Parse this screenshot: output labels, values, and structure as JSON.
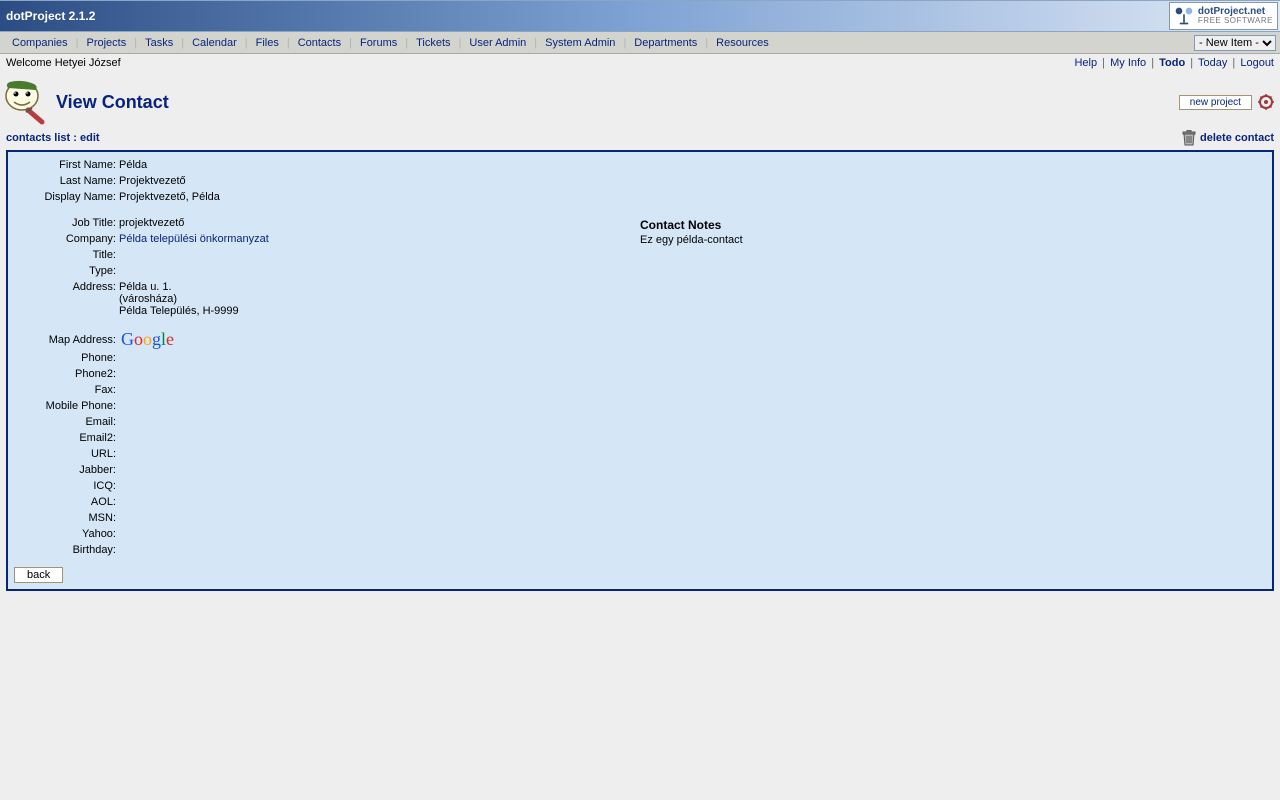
{
  "header": {
    "title": "dotProject 2.1.2",
    "logo_line1": "dotProject.net",
    "logo_line2": "FREE SOFTWARE"
  },
  "nav": {
    "items": [
      "Companies",
      "Projects",
      "Tasks",
      "Calendar",
      "Files",
      "Contacts",
      "Forums",
      "Tickets",
      "User Admin",
      "System Admin",
      "Departments",
      "Resources"
    ],
    "dropdown_selected": "- New Item -"
  },
  "util": {
    "welcome": "Welcome Hetyei József",
    "links": {
      "help": "Help",
      "myinfo": "My Info",
      "todo": "Todo",
      "today": "Today",
      "logout": "Logout"
    }
  },
  "page": {
    "title": "View Contact",
    "new_project": "new project",
    "crumb_list": "contacts list",
    "crumb_edit": "edit",
    "delete": "delete contact",
    "back": "back"
  },
  "labels": {
    "first_name": "First Name:",
    "last_name": "Last Name:",
    "display_name": "Display Name:",
    "job_title": "Job Title:",
    "company": "Company:",
    "title": "Title:",
    "type": "Type:",
    "address": "Address:",
    "map_address": "Map Address:",
    "phone": "Phone:",
    "phone2": "Phone2:",
    "fax": "Fax:",
    "mobile": "Mobile Phone:",
    "email": "Email:",
    "email2": "Email2:",
    "url": "URL:",
    "jabber": "Jabber:",
    "icq": "ICQ:",
    "aol": "AOL:",
    "msn": "MSN:",
    "yahoo": "Yahoo:",
    "birthday": "Birthday:"
  },
  "contact": {
    "first_name": "Példa",
    "last_name": "Projektvezető",
    "display_name": "Projektvezető, Példa",
    "job_title": "projektvezető",
    "company": "Példa települési önkormanyzat",
    "title": "",
    "type": "",
    "address_l1": "Példa u. 1.",
    "address_l2": "(városháza)",
    "address_l3": "Példa Település, H-9999",
    "phone": "",
    "phone2": "",
    "fax": "",
    "mobile": "",
    "email": "",
    "email2": "",
    "url": "",
    "jabber": "",
    "icq": "",
    "aol": "",
    "msn": "",
    "yahoo": "",
    "birthday": ""
  },
  "notes": {
    "title": "Contact Notes",
    "body": "Ez egy példa-contact"
  }
}
